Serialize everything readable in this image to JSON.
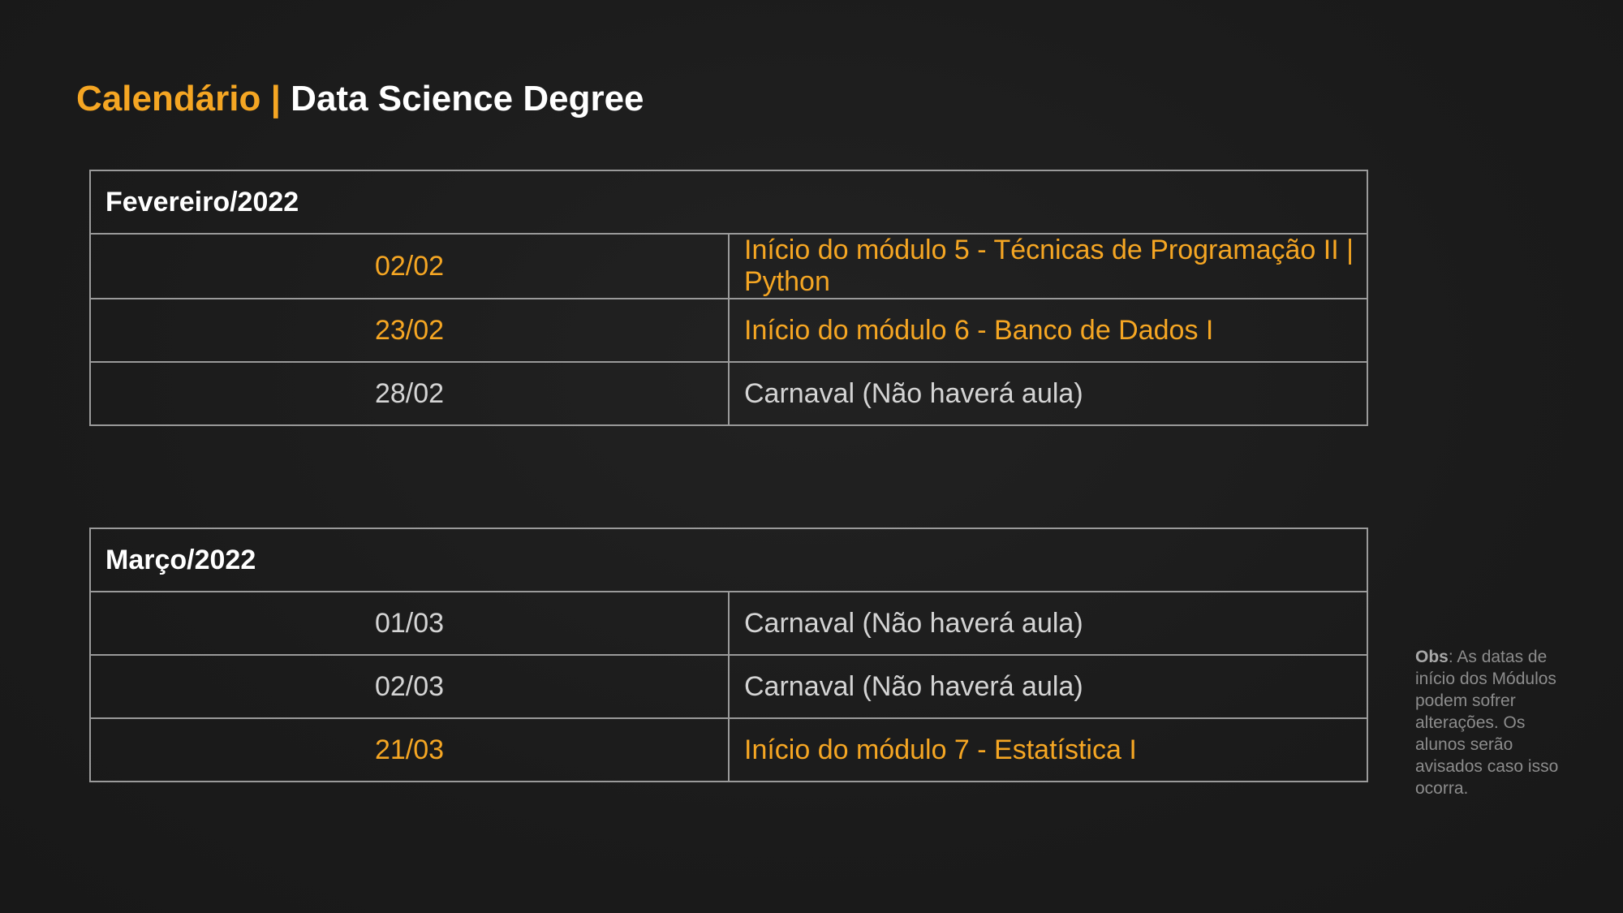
{
  "title": {
    "accent": "Calendário |",
    "main": "Data Science Degree"
  },
  "colors": {
    "accent": "#f5a623",
    "text": "#d4d4d4",
    "background": "#1c1c1c",
    "border": "#9a9a9a"
  },
  "months": [
    {
      "label": "Fevereiro/2022",
      "rows": [
        {
          "date": "02/02",
          "event": "Início do módulo 5 - Técnicas de Programação II | Python",
          "highlight": true
        },
        {
          "date": "23/02",
          "event": "Início do módulo 6 - Banco de Dados I",
          "highlight": true
        },
        {
          "date": "28/02",
          "event": "Carnaval (Não haverá aula)",
          "highlight": false
        }
      ]
    },
    {
      "label": "Março/2022",
      "rows": [
        {
          "date": "01/03",
          "event": "Carnaval (Não haverá aula)",
          "highlight": false
        },
        {
          "date": "02/03",
          "event": "Carnaval (Não haverá aula)",
          "highlight": false
        },
        {
          "date": "21/03",
          "event": "Início do módulo 7 - Estatística I",
          "highlight": true
        }
      ]
    }
  ],
  "note": {
    "label": "Obs",
    "text": ": As datas de início dos Módulos podem sofrer alterações. Os alunos serão avisados caso isso ocorra."
  }
}
